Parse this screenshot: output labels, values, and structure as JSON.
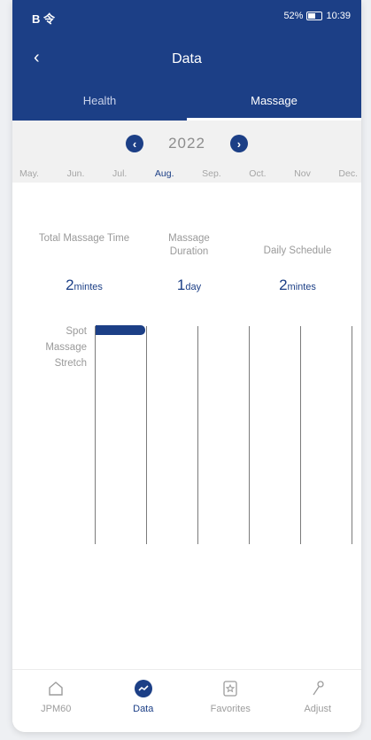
{
  "status": {
    "left": "B 令",
    "battery": "52%",
    "time": "10:39"
  },
  "nav": {
    "title": "Data"
  },
  "tabs": [
    {
      "label": "Health"
    },
    {
      "label": "Massage"
    }
  ],
  "year": "2022",
  "months": [
    "May.",
    "Jun.",
    "Jul.",
    "Aug.",
    "Sep.",
    "Oct.",
    "Nov",
    "Dec."
  ],
  "active_month": "Aug.",
  "stats": {
    "total_time_label": "Total Massage Time",
    "total_time_value": "2",
    "total_time_unit": "mintes",
    "duration_label": "Massage Duration",
    "duration_value": "1",
    "duration_unit": "day",
    "schedule_label": "Daily Schedule",
    "schedule_value": "2",
    "schedule_unit": "mintes"
  },
  "chart_rows": [
    "Spot",
    "Massage",
    "Stretch"
  ],
  "tabbar": [
    {
      "label": "JPM60",
      "icon": "home-icon"
    },
    {
      "label": "Data",
      "icon": "data-chart-icon"
    },
    {
      "label": "Favorites",
      "icon": "favorites-icon"
    },
    {
      "label": "Adjust",
      "icon": "adjust-icon"
    }
  ],
  "colors": {
    "primary": "#1c3f86",
    "muted": "#9a9a9a"
  }
}
